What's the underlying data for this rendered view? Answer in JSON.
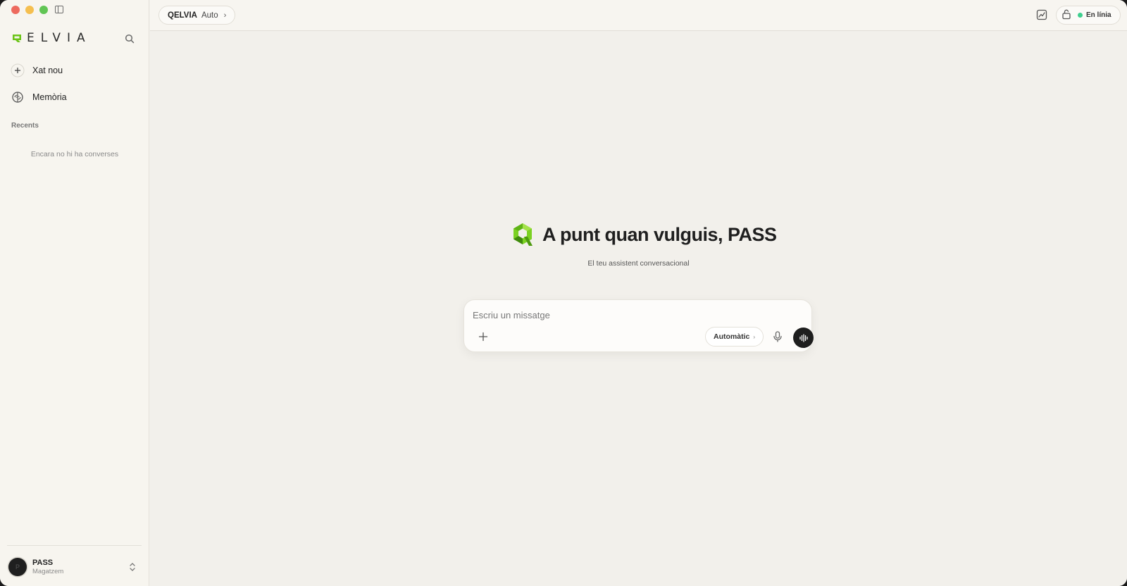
{
  "app": {
    "logo_text": "ELVIA",
    "accent_color": "#6cc418"
  },
  "sidebar": {
    "search_icon": "search-icon",
    "items": [
      {
        "label": "Xat nou",
        "icon": "plus-icon"
      },
      {
        "label": "Memòria",
        "icon": "brain-icon"
      }
    ],
    "recents_label": "Recents",
    "empty_text": "Encara no hi ha converses",
    "user": {
      "initial": "P",
      "name": "PASS",
      "subtitle": "Magatzem"
    }
  },
  "topbar": {
    "model_name": "QELVIA",
    "model_mode": "Auto",
    "model_chevron": "›",
    "status_label": "En línia",
    "status_color": "#3ecf8e"
  },
  "hero": {
    "title": "A punt quan vulguis, PASS",
    "subtitle": "El teu assistent conversacional"
  },
  "composer": {
    "placeholder": "Escriu un missatge",
    "value": "",
    "mode_label": "Automàtic",
    "mode_chevron": "›"
  }
}
